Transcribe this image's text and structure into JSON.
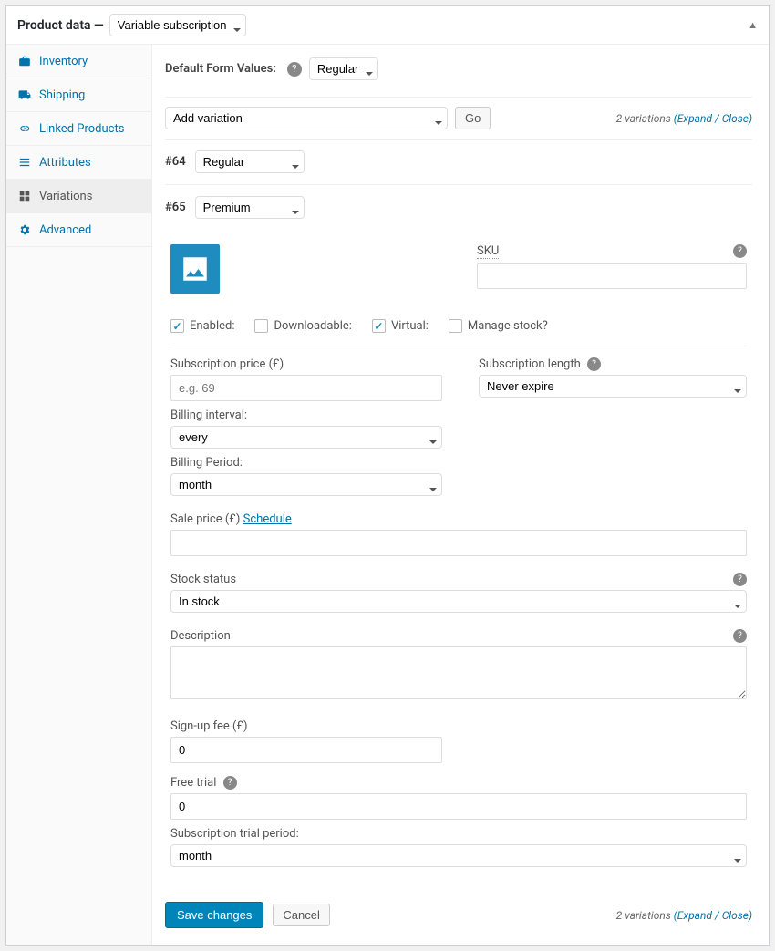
{
  "header": {
    "title": "Product data —",
    "product_type": "Variable subscription"
  },
  "sidebar": {
    "items": [
      {
        "label": "Inventory"
      },
      {
        "label": "Shipping"
      },
      {
        "label": "Linked Products"
      },
      {
        "label": "Attributes"
      },
      {
        "label": "Variations"
      },
      {
        "label": "Advanced"
      }
    ]
  },
  "main": {
    "default_form_label": "Default Form Values:",
    "default_form_value": "Regular",
    "add_variation_label": "Add variation",
    "go_label": "Go",
    "variations_count_text": "2 variations",
    "expand_label": "Expand",
    "close_label": "Close",
    "variations": [
      {
        "id": "#64",
        "attr": "Regular"
      },
      {
        "id": "#65",
        "attr": "Premium"
      }
    ],
    "sku_label": "SKU",
    "checks": {
      "enabled": "Enabled:",
      "downloadable": "Downloadable:",
      "virtual": "Virtual:",
      "manage_stock": "Manage stock?"
    },
    "subscription_price_label": "Subscription price (£)",
    "subscription_price_placeholder": "e.g. 69",
    "billing_interval_label": "Billing interval:",
    "billing_interval_value": "every",
    "billing_period_label": "Billing Period:",
    "billing_period_value": "month",
    "subscription_length_label": "Subscription length",
    "subscription_length_value": "Never expire",
    "sale_price_label": "Sale price (£)",
    "schedule_link": "Schedule",
    "stock_status_label": "Stock status",
    "stock_status_value": "In stock",
    "description_label": "Description",
    "signup_fee_label": "Sign-up fee (£)",
    "signup_fee_value": "0",
    "free_trial_label": "Free trial",
    "free_trial_value": "0",
    "trial_period_label": "Subscription trial period:",
    "trial_period_value": "month",
    "save_label": "Save changes",
    "cancel_label": "Cancel"
  }
}
